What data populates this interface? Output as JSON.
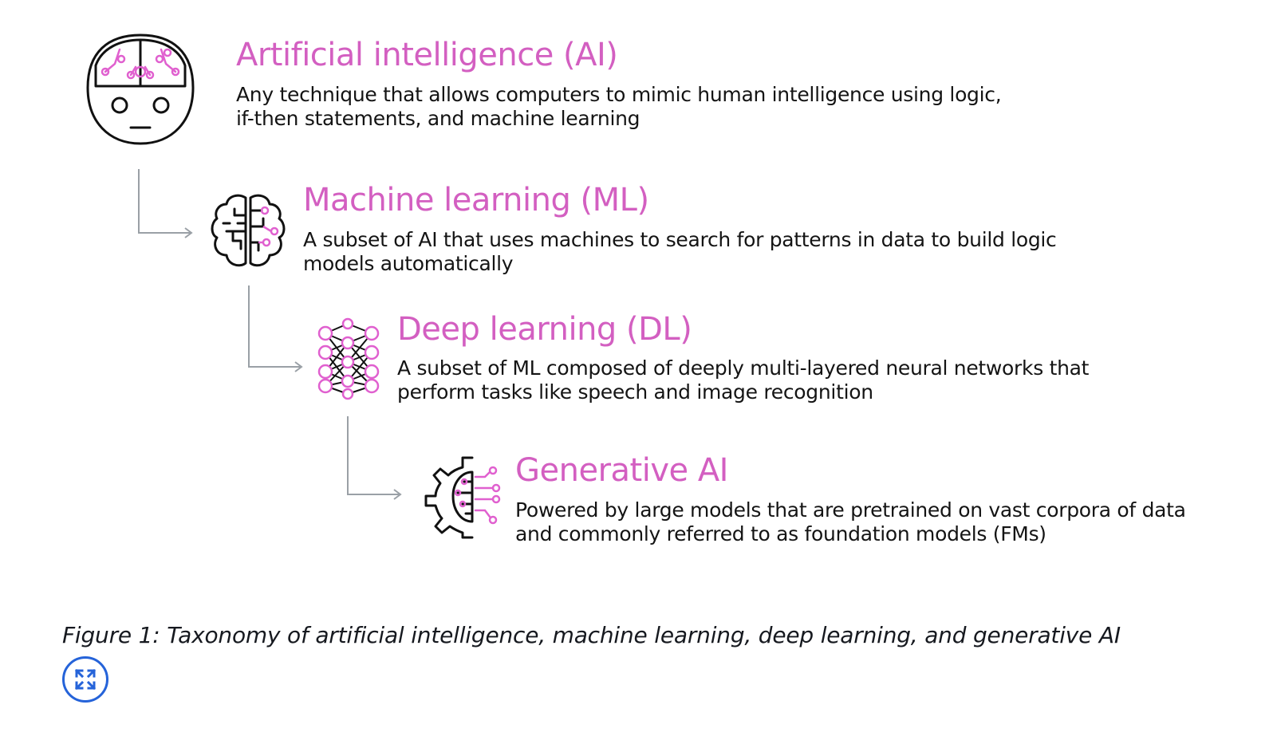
{
  "levels": [
    {
      "title": "Artificial intelligence (AI)",
      "desc_line1": "Any technique that allows computers to mimic human intelligence using logic,",
      "desc_line2": "if-then statements, and machine learning",
      "icon": "robot-head-icon"
    },
    {
      "title": "Machine learning (ML)",
      "desc_line1": "A subset of AI that uses machines to search for patterns in data to build logic",
      "desc_line2": "models automatically",
      "icon": "brain-circuit-icon"
    },
    {
      "title": "Deep learning (DL)",
      "desc_line1": "A subset of ML composed of deeply multi-layered neural networks that",
      "desc_line2": "perform tasks like speech and image recognition",
      "icon": "neural-network-icon"
    },
    {
      "title": "Generative AI",
      "desc_line1": "Powered by large models that are pretrained on vast corpora of data",
      "desc_line2": "and commonly referred to as foundation models (FMs)",
      "icon": "gear-brain-icon"
    }
  ],
  "caption": "Figure 1: Taxonomy of artificial intelligence, machine learning, deep learning, and generative AI",
  "expand_button": {
    "icon": "expand-icon"
  },
  "colors": {
    "title": "#d35fc1",
    "icon_accent": "#e060cf",
    "icon_stroke": "#111111",
    "connector": "#9aa0a6",
    "expand_button": "#2563d9"
  }
}
